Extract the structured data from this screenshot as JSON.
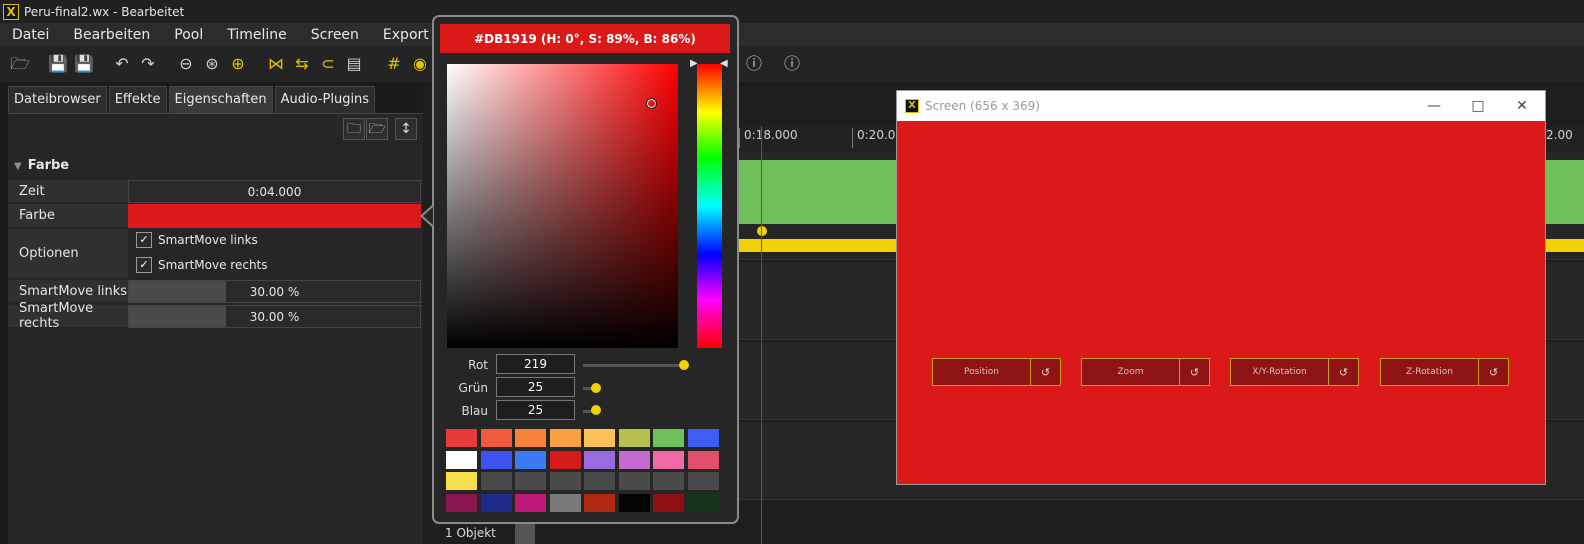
{
  "window": {
    "title": "Peru-final2.wx - Bearbeitet",
    "logo": "X"
  },
  "menu": [
    "Datei",
    "Bearbeiten",
    "Pool",
    "Timeline",
    "Screen",
    "Export"
  ],
  "tabs": [
    "Dateibrowser",
    "Effekte",
    "Eigenschaften",
    "Audio-Plugins"
  ],
  "active_tab": "Eigenschaften",
  "section": {
    "title": "Farbe"
  },
  "properties": {
    "zeit": {
      "label": "Zeit",
      "value": "0:04.000"
    },
    "farbe": {
      "label": "Farbe",
      "color": "#DB1919"
    },
    "optionen": {
      "label": "Optionen",
      "check1": "SmartMove links",
      "check2": "SmartMove rechts"
    },
    "sm_links": {
      "label": "SmartMove links",
      "value": "30.00 %",
      "fraction": 0.3
    },
    "sm_rechts": {
      "label": "SmartMove rechts",
      "value": "30.00 %",
      "fraction": 0.3
    }
  },
  "timeline": {
    "ruler": [
      "0:18.000",
      "0:20.00",
      "2.00"
    ],
    "status": "1 Objekt",
    "clip_color": "#6fbf5a",
    "track_color": "#f1d200"
  },
  "picker": {
    "header": "#DB1919 (H: 0°, S: 89%, B: 86%)",
    "rot_label": "Rot",
    "rot": "219",
    "rot_fraction": 0.86,
    "gruen_label": "Grün",
    "gruen": "25",
    "gruen_fraction": 0.1,
    "blau_label": "Blau",
    "blau": "25",
    "blau_fraction": 0.1,
    "swatches": [
      "#e53b3b",
      "#f15a3c",
      "#f7823c",
      "#f9a040",
      "#fbc25a",
      "#b5c14c",
      "#6fbf5a",
      "#3e5ef2",
      "#ffffff",
      "#3d54f2",
      "#3b7af2",
      "#d61a1a",
      "#9a6ae0",
      "#c66ad0",
      "#ef6aa6",
      "#e0506a",
      "#f6df4a",
      "#4a4a4a",
      "#4a4a4a",
      "#4a4a4a",
      "#4a4a4a",
      "#4a4a4a",
      "#4a4a4a",
      "#4a4a4a",
      "#8a1650",
      "#1f2a8a",
      "#c0177a",
      "#7a7a7a",
      "#b02a10",
      "#050505",
      "#8e1010",
      "#17351a"
    ]
  },
  "screen_window": {
    "title": "Screen (656 x 369)",
    "logo": "X",
    "buttons": [
      "Position",
      "Zoom",
      "X/Y-Rotation",
      "Z-Rotation"
    ],
    "background": "#DB1919"
  },
  "colors": {
    "accent": "#e3c100",
    "background": "#1b1b1b"
  }
}
